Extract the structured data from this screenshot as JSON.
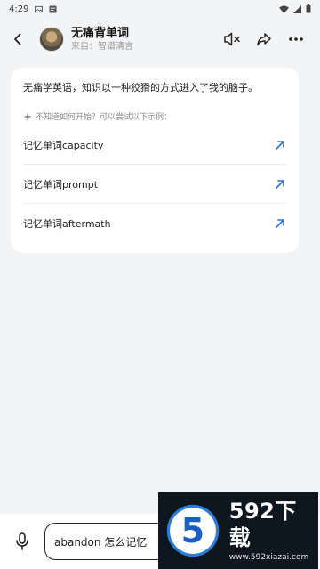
{
  "status_bar": {
    "time": "4:29"
  },
  "header": {
    "title": "无痛背单词",
    "subtitle": "来自：智谱清言"
  },
  "card": {
    "intro": "无痛学英语，知识以一种狡猾的方式进入了我的脑子。",
    "hint": "不知道如何开始？可以尝试以下示例：",
    "examples": [
      {
        "label": "记忆单词capacity"
      },
      {
        "label": "记忆单词prompt"
      },
      {
        "label": "记忆单词aftermath"
      }
    ]
  },
  "input": {
    "value": "abandon 怎么记忆"
  },
  "watermark": {
    "logo_text": "5",
    "name": "592下载",
    "url": "www.592xiazai.com"
  },
  "colors": {
    "accent": "#2b6fe0",
    "background": "#f3f4f6"
  }
}
